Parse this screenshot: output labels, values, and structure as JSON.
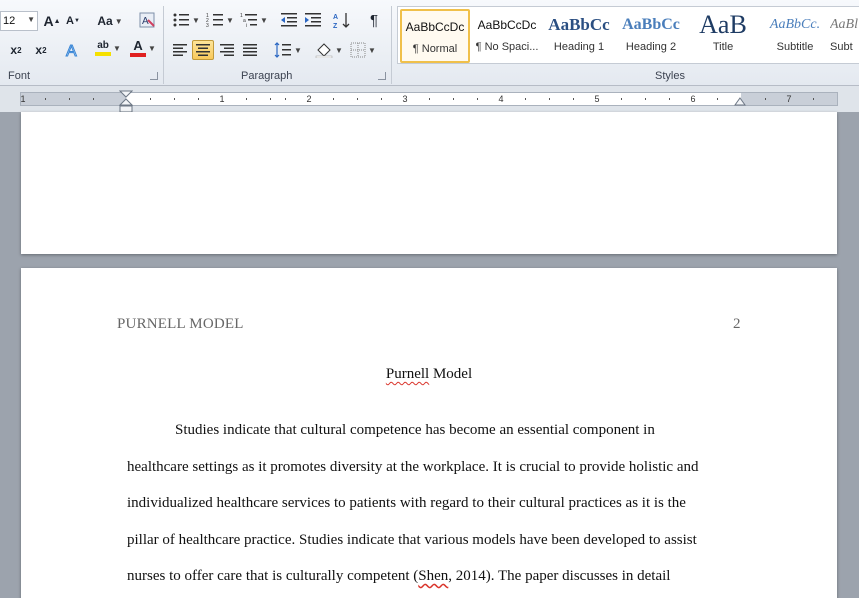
{
  "ribbon": {
    "font_size": "12",
    "groups": {
      "font": "Font",
      "paragraph": "Paragraph",
      "styles": "Styles"
    },
    "buttons": {
      "grow_font": "A",
      "shrink_font": "A",
      "change_case": "Aa",
      "subscript": "x",
      "superscript": "x",
      "font_color": "A",
      "highlight": "ab",
      "pilcrow": "¶"
    },
    "styles": [
      {
        "sample": "AaBbCcDc",
        "name": "¶ Normal",
        "selected": true
      },
      {
        "sample": "AaBbCcDc",
        "name": "¶ No Spaci..."
      },
      {
        "sample": "AaBbCc",
        "name": "Heading 1"
      },
      {
        "sample": "AaBbCc",
        "name": "Heading 2"
      },
      {
        "sample": "AaB",
        "name": "Title"
      },
      {
        "sample": "AaBbCc.",
        "name": "Subtitle"
      },
      {
        "sample": "AaBl",
        "name": "Subt"
      }
    ],
    "colors": {
      "highlight_bar": "#f5e000",
      "font_color_bar": "#e02020",
      "accent": "#f0c04a"
    }
  },
  "ruler": {
    "numbers": [
      "1",
      "1",
      "2",
      "3",
      "4",
      "5",
      "6",
      "7"
    ]
  },
  "document": {
    "running_head": "PURNELL MODEL",
    "page_number": "2",
    "title_word1": "Purnell",
    "title_word2": " Model",
    "lines": [
      "Studies indicate that cultural competence has become an essential component in",
      "healthcare settings as it promotes diversity at the workplace. It is crucial to provide holistic and",
      "individualized healthcare services to patients with regard to their cultural practices as it is the",
      "pillar of healthcare practice. Studies indicate that various models have been developed to assist"
    ],
    "line5_pre": "nurses to offer care that is culturally competent (",
    "line5_sq": "Shen",
    "line5_post": ", 2014). The paper discusses in detail"
  }
}
